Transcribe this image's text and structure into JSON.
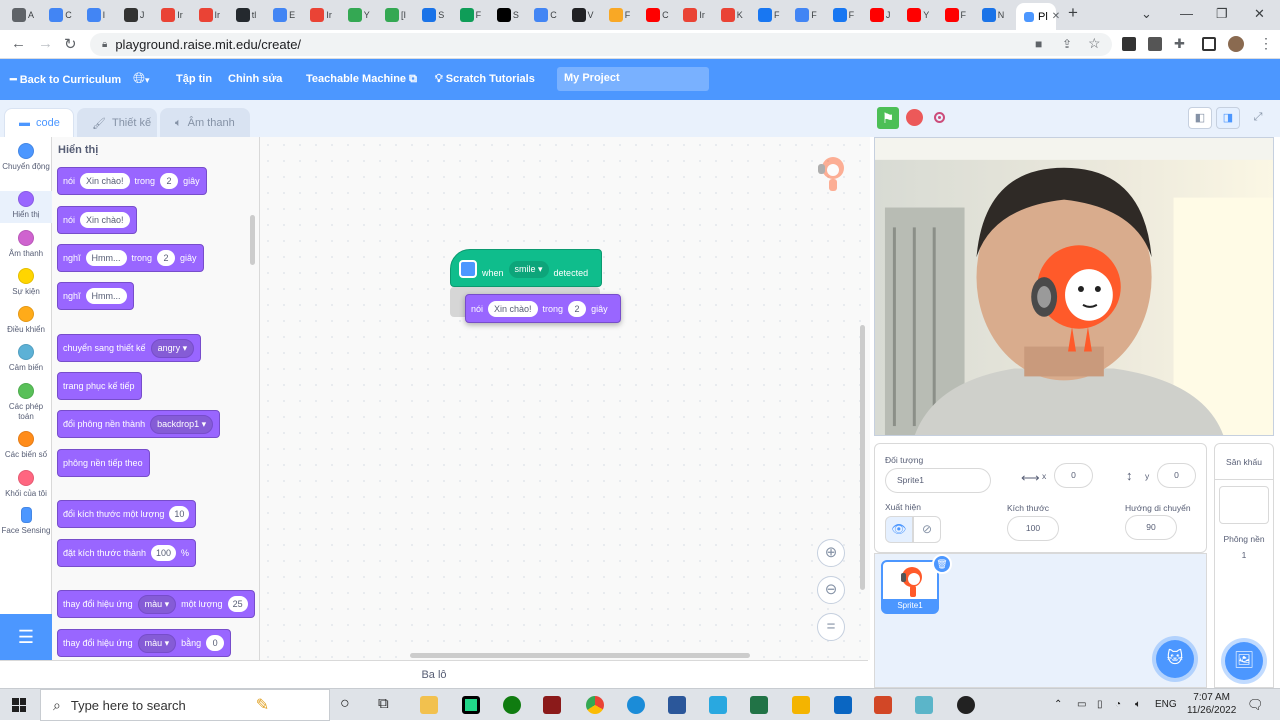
{
  "browser": {
    "tab_titles": [
      "A",
      "C",
      "I",
      "J",
      "Ir",
      "Ir",
      "tl",
      "E",
      "Ir",
      "Y",
      "[I",
      "S",
      "F",
      "S",
      "C",
      "V",
      "F",
      "C",
      "Ir",
      "K",
      "F",
      "F",
      "F",
      "J",
      "Y",
      "F",
      "N"
    ],
    "active_tab_title": "Pl",
    "url": "playground.raise.mit.edu/create/"
  },
  "menu": {
    "back_label": "Back to Curriculum",
    "file_label": "Tập tin",
    "edit_label": "Chỉnh sửa",
    "teachable_label": "Teachable Machine",
    "tutorials_label": "Scratch Tutorials",
    "project_title": "My Project"
  },
  "editor_tabs": {
    "code": "code",
    "costumes": "Thiết kế",
    "sounds": "Âm thanh"
  },
  "categories": [
    {
      "label": "Chuyển động",
      "color": "#4c97ff"
    },
    {
      "label": "Hiển thị",
      "color": "#9966ff"
    },
    {
      "label": "Âm thanh",
      "color": "#cf63cf"
    },
    {
      "label": "Sự kiện",
      "color": "#ffd500"
    },
    {
      "label": "Điều khiển",
      "color": "#ffab19"
    },
    {
      "label": "Cảm biến",
      "color": "#5cb1d6"
    },
    {
      "label": "Các phép toán",
      "color": "#59c059"
    },
    {
      "label": "Các biến số",
      "color": "#ff8c1a"
    },
    {
      "label": "Khối của tôi",
      "color": "#ff6680"
    },
    {
      "label": "Face Sensing",
      "color": "#4c97ff"
    }
  ],
  "palette": {
    "heading": "Hiển thị",
    "blocks": [
      {
        "parts": [
          {
            "t": "text",
            "v": "nói"
          },
          {
            "t": "pill",
            "v": "Xin chào!"
          },
          {
            "t": "text",
            "v": "trong"
          },
          {
            "t": "num",
            "v": "2"
          },
          {
            "t": "text",
            "v": "giây"
          }
        ]
      },
      {
        "parts": [
          {
            "t": "text",
            "v": "nói"
          },
          {
            "t": "pill",
            "v": "Xin chào!"
          }
        ]
      },
      {
        "parts": [
          {
            "t": "text",
            "v": "nghĩ"
          },
          {
            "t": "pill",
            "v": "Hmm..."
          },
          {
            "t": "text",
            "v": "trong"
          },
          {
            "t": "num",
            "v": "2"
          },
          {
            "t": "text",
            "v": "giây"
          }
        ]
      },
      {
        "parts": [
          {
            "t": "text",
            "v": "nghĩ"
          },
          {
            "t": "pill",
            "v": "Hmm..."
          }
        ]
      },
      {
        "parts": [
          {
            "t": "text",
            "v": "chuyển sang thiết kế"
          },
          {
            "t": "drop",
            "v": "angry ▾"
          }
        ]
      },
      {
        "parts": [
          {
            "t": "text",
            "v": "trang phục kế tiếp"
          }
        ]
      },
      {
        "parts": [
          {
            "t": "text",
            "v": "đổi phông nền thành"
          },
          {
            "t": "drop",
            "v": "backdrop1 ▾"
          }
        ]
      },
      {
        "parts": [
          {
            "t": "text",
            "v": "phông nền tiếp theo"
          }
        ]
      },
      {
        "parts": [
          {
            "t": "text",
            "v": "đổi kích thước một lượng"
          },
          {
            "t": "num",
            "v": "10"
          }
        ]
      },
      {
        "parts": [
          {
            "t": "text",
            "v": "đặt kích thước thành"
          },
          {
            "t": "num",
            "v": "100"
          },
          {
            "t": "text",
            "v": "%"
          }
        ]
      },
      {
        "parts": [
          {
            "t": "text",
            "v": "thay đổi hiệu ứng"
          },
          {
            "t": "drop",
            "v": "màu ▾"
          },
          {
            "t": "text",
            "v": "một lượng"
          },
          {
            "t": "num",
            "v": "25"
          }
        ]
      },
      {
        "parts": [
          {
            "t": "text",
            "v": "thay đổi hiệu ứng"
          },
          {
            "t": "drop",
            "v": "màu ▾"
          },
          {
            "t": "text",
            "v": "bằng"
          },
          {
            "t": "num",
            "v": "0"
          }
        ]
      }
    ]
  },
  "workspace": {
    "hat": {
      "when": "when",
      "expression": "smile ▾",
      "detected": "detected"
    },
    "dragged": {
      "verb": "nói",
      "message": "Xin chào!",
      "within": "trong",
      "seconds": "2",
      "unit": "giây"
    },
    "backpack_label": "Ba lô"
  },
  "sprite_info": {
    "sprite_label": "Đối tượng",
    "sprite_name": "Sprite1",
    "x_label": "x",
    "x_value": "0",
    "y_label": "y",
    "y_value": "0",
    "show_label": "Xuất hiện",
    "size_label": "Kích thước",
    "size_value": "100",
    "direction_label": "Hướng di chuyển",
    "direction_value": "90"
  },
  "sprite_list": {
    "thumb_name": "Sprite1"
  },
  "stage_pane": {
    "title": "Sân khấu",
    "backdrops_label": "Phông nền",
    "backdrops_count": "1"
  },
  "taskbar": {
    "search_placeholder": "Type here to search",
    "lang": "ENG",
    "time": "7:07 AM",
    "date": "11/26/2022"
  },
  "colors": {
    "scratch_blue": "#4c97ff",
    "looks_purple": "#9966ff",
    "extension_green": "#0fbd8c"
  }
}
